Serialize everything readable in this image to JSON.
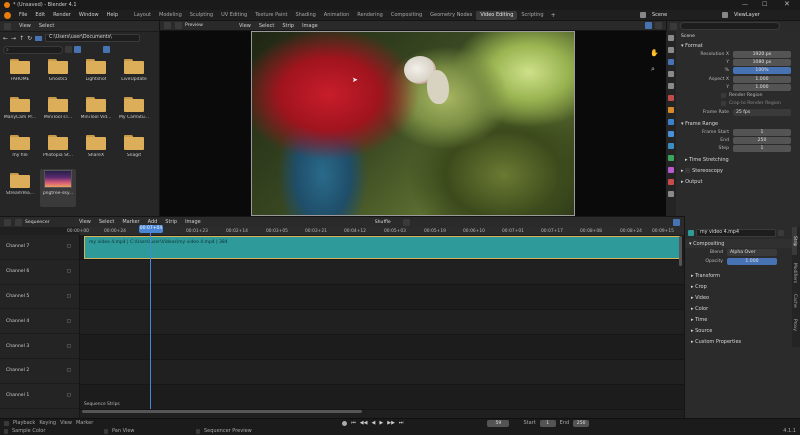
{
  "window": {
    "title": "* (Unsaved) - Blender 4.1"
  },
  "menu": {
    "items": [
      "File",
      "Edit",
      "Render",
      "Window",
      "Help"
    ]
  },
  "workspaces": [
    "Layout",
    "Modeling",
    "Sculpting",
    "UV Editing",
    "Texture Paint",
    "Shading",
    "Animation",
    "Rendering",
    "Compositing",
    "Geometry Nodes",
    "Video Editing",
    "Scripting"
  ],
  "workspace_active": "Video Editing",
  "scene": {
    "label": "Scene",
    "view_layer": "ViewLayer"
  },
  "file_browser": {
    "menu": [
      "View",
      "Select"
    ],
    "path": "C:\\Users\\user\\Documents\\",
    "search_placeholder": "",
    "items": [
      {
        "label": "FAHOME",
        "type": "folder"
      },
      {
        "label": "Ghosts5",
        "type": "folder"
      },
      {
        "label": "Lightshot",
        "type": "folder"
      },
      {
        "label": "LiveUpdate",
        "type": "folder"
      },
      {
        "label": "ManyCam Pr...",
        "type": "folder"
      },
      {
        "label": "MiniTool sT...",
        "type": "folder"
      },
      {
        "label": "MiniTool Vid...",
        "type": "folder"
      },
      {
        "label": "My CamStu...",
        "type": "folder"
      },
      {
        "label": "my file",
        "type": "folder"
      },
      {
        "label": "Photopia St...",
        "type": "folder"
      },
      {
        "label": "ShareX",
        "type": "folder"
      },
      {
        "label": "Snagit",
        "type": "folder"
      },
      {
        "label": "StreamYea...",
        "type": "folder"
      },
      {
        "label": "pngtree-sky...",
        "type": "image"
      }
    ]
  },
  "preview": {
    "mode": "Preview",
    "menu": [
      "View",
      "Select",
      "Strip",
      "Image"
    ]
  },
  "properties": {
    "section_scene": "Scene",
    "format_title": "Format",
    "resolution_x_label": "Resolution X",
    "resolution_x": "1920 px",
    "resolution_y_label": "Y",
    "resolution_y": "1080 px",
    "percent_label": "%",
    "percent": "100%",
    "aspect_x_label": "Aspect X",
    "aspect_x": "1.000",
    "aspect_y_label": "Y",
    "aspect_y": "1.000",
    "render_region": "Render Region",
    "crop_region": "Crop to Render Region",
    "frame_rate_label": "Frame Rate",
    "frame_rate": "25 fps",
    "frame_range_title": "Frame Range",
    "frame_start_label": "Frame Start",
    "frame_start": "1",
    "end_label": "End",
    "end": "250",
    "step_label": "Step",
    "step": "1",
    "time_stretching": "Time Stretching",
    "stereoscopy": "Stereoscopy",
    "output": "Output"
  },
  "sequencer": {
    "editor": "Sequencer",
    "menu": [
      "View",
      "Select",
      "Marker",
      "Add",
      "Strip",
      "Image"
    ],
    "shuffle": "Shuffle",
    "timecodes": [
      "00:00+00",
      "00:00+24",
      "00:01+23",
      "00:02+14",
      "00:03+05",
      "00:03+21",
      "00:04+12",
      "00:05+03",
      "00:05+19",
      "00:06+10",
      "00:07+01",
      "00:07+17",
      "00:08+08",
      "00:08+24",
      "00:09+15"
    ],
    "current": "00:07+04",
    "channels": [
      "Channel 7",
      "Channel 6",
      "Channel 5",
      "Channel 4",
      "Channel 3",
      "Channel 2",
      "Channel 1"
    ],
    "strip_label": "my video 4.mp4 | C:\\Users\\user\\Videos\\my video 4.mp4 | 384",
    "guide_label": "Sequence Strips"
  },
  "strip_props": {
    "name": "my video 4.mp4",
    "compositing": "Compositing",
    "blend_label": "Blend",
    "blend": "Alpha Over",
    "opacity_label": "Opacity",
    "opacity": "1.000",
    "sections": [
      "Transform",
      "Crop",
      "Video",
      "Color",
      "Time",
      "Source",
      "Custom Properties"
    ],
    "side_tabs": [
      "Strip",
      "Modifiers",
      "Cache",
      "Proxy"
    ]
  },
  "statusbar": {
    "playback": "Playback",
    "keying": "Keying",
    "view": "View",
    "marker": "Marker",
    "frame": "59",
    "start_label": "Start",
    "start": "1",
    "end_label": "End",
    "end": "250",
    "hints": [
      "Sample Color",
      "Pan View",
      "Sequencer Preview"
    ],
    "version": "4.1.1"
  }
}
